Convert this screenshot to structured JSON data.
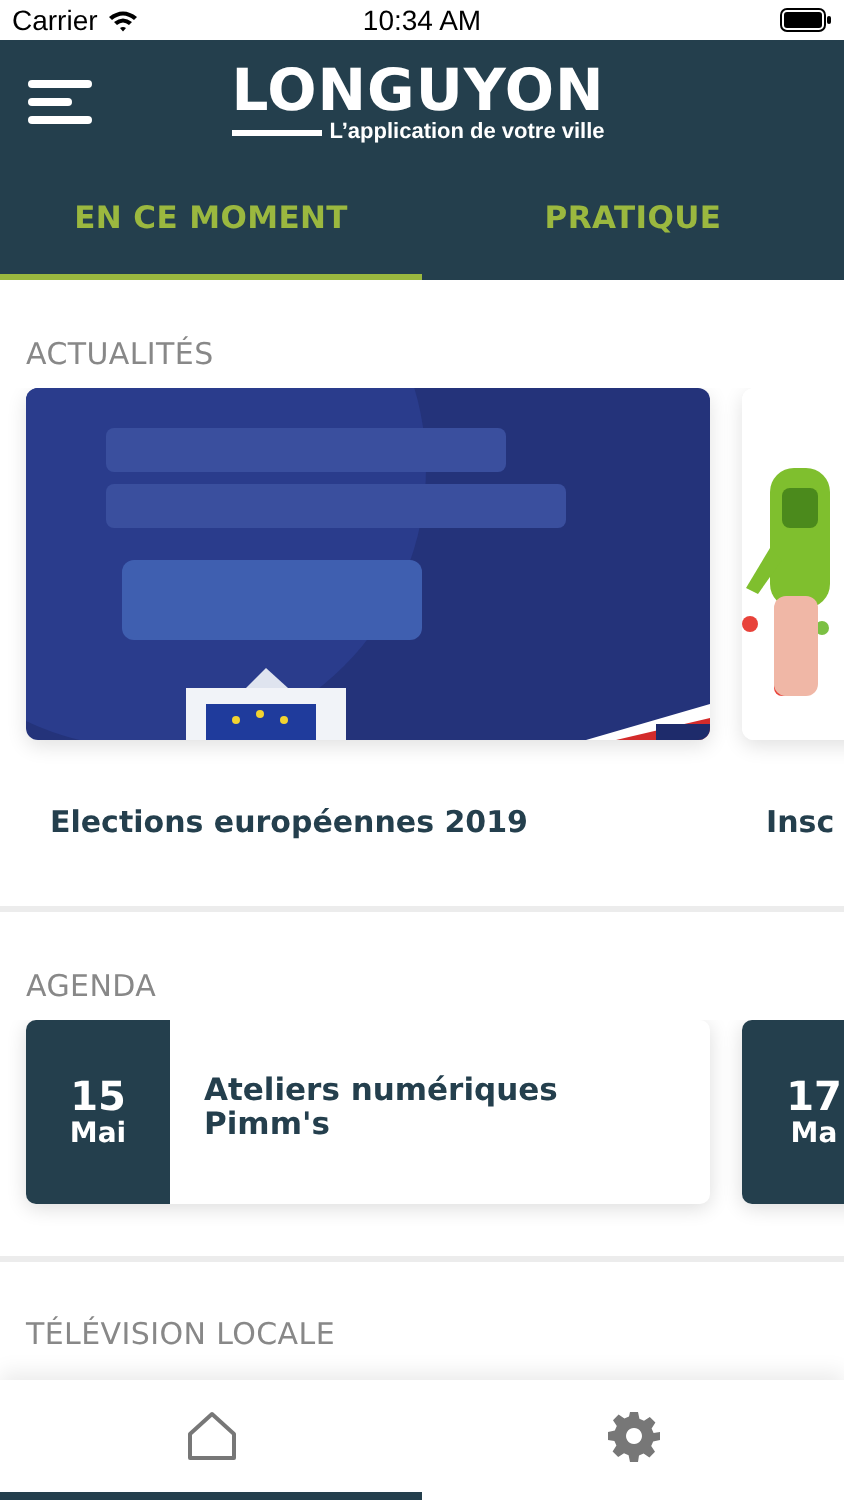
{
  "status_bar": {
    "carrier": "Carrier",
    "time": "10:34 AM"
  },
  "header": {
    "logo_title": "LONGUYON",
    "logo_subtitle": "L’application de votre ville"
  },
  "tabs": [
    {
      "label": "EN CE MOMENT",
      "selected": true
    },
    {
      "label": "PRATIQUE",
      "selected": false
    }
  ],
  "news": {
    "title": "ACTUALITÉS",
    "items": [
      {
        "title": "Elections européennes 2019",
        "kind": "picture"
      },
      {
        "title": "Insc",
        "kind": "picture"
      }
    ]
  },
  "agenda": {
    "title": "AGENDA",
    "items": [
      {
        "day": "15",
        "month": "Mai",
        "title": "Ateliers numériques Pimm's"
      },
      {
        "day": "17",
        "month": "Ma"
      }
    ]
  },
  "tv": {
    "title": "TÉLÉVISION LOCALE"
  },
  "bottom_nav": [
    {
      "kind": "home",
      "selected": true
    },
    {
      "kind": "settings",
      "selected": false
    }
  ]
}
